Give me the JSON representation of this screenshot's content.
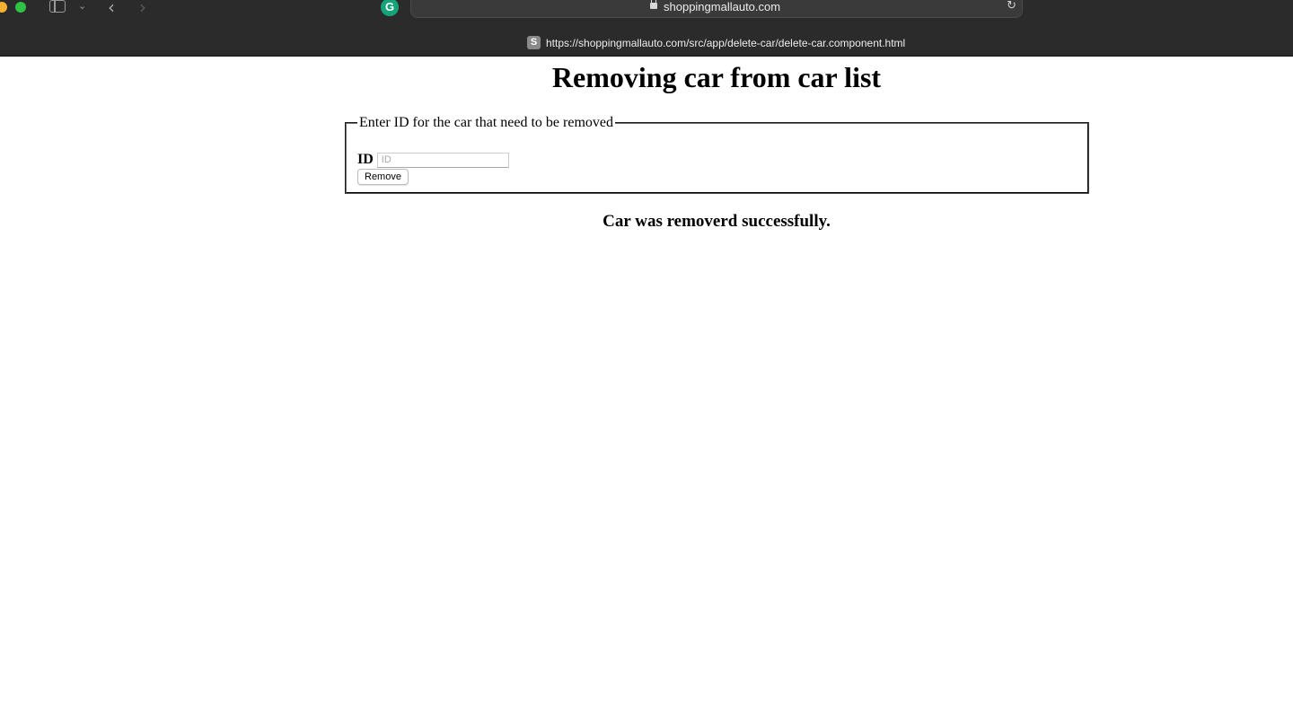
{
  "browser": {
    "domain": "shoppingmallauto.com",
    "tab_url": "https://shoppingmallauto.com/src/app/delete-car/delete-car.component.html",
    "favicon_letter": "S",
    "extension_letter": "G",
    "icons": [
      "sidebar-icon",
      "chevron-down-icon",
      "back-icon",
      "forward-icon",
      "lock-icon",
      "reload-icon"
    ]
  },
  "page": {
    "title": "Removing car from car list",
    "form": {
      "legend": "Enter ID for the car that need to be removed",
      "id_label": "ID",
      "id_placeholder": "ID",
      "id_value": "",
      "submit_label": "Remove"
    },
    "status_message": "Car was removerd successfully."
  },
  "colors": {
    "chrome_bg": "#2b2b2b",
    "traffic_yellow": "#f5b130",
    "traffic_green": "#2fc244",
    "grammarly_green": "#15a47a"
  }
}
